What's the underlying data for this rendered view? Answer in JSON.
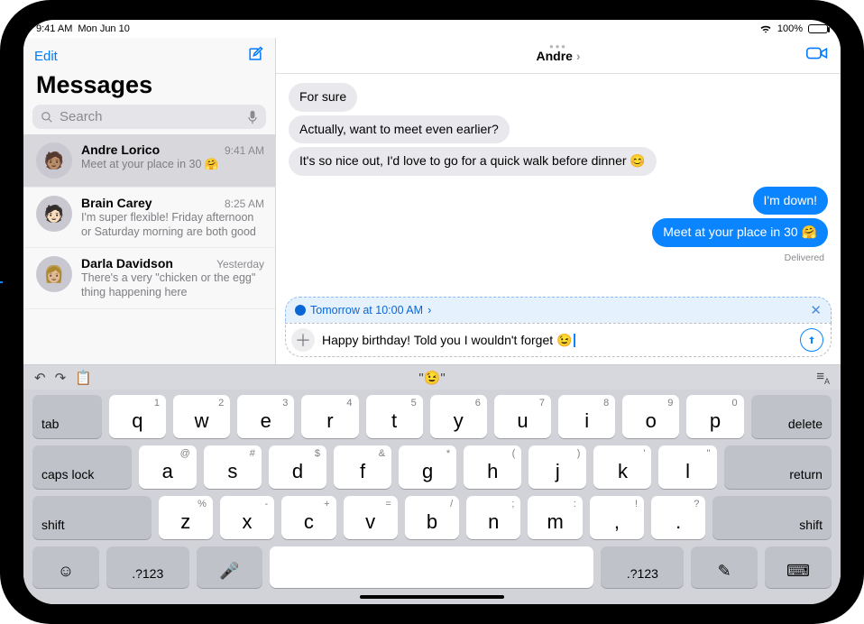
{
  "status": {
    "time": "9:41 AM",
    "date": "Mon Jun 10",
    "battery": "100%"
  },
  "sidebar": {
    "edit": "Edit",
    "title": "Messages",
    "search_placeholder": "Search",
    "conversations": [
      {
        "name": "Andre Lorico",
        "time": "9:41 AM",
        "preview": "Meet at your place in 30 🤗"
      },
      {
        "name": "Brain Carey",
        "time": "8:25 AM",
        "preview": "I'm super flexible! Friday afternoon or Saturday morning are both good"
      },
      {
        "name": "Darla Davidson",
        "time": "Yesterday",
        "preview": "There's a very \"chicken or the egg\" thing happening here"
      }
    ]
  },
  "chat": {
    "title": "Andre",
    "incoming": [
      "For sure",
      "Actually, want to meet even earlier?",
      "It's so nice out, I'd love to go for a quick walk before dinner 😊"
    ],
    "outgoing": [
      "I'm down!",
      "Meet at your place in 30 🤗"
    ],
    "delivered": "Delivered",
    "schedule_label": "Tomorrow at 10:00 AM",
    "compose_text": "Happy birthday! Told you I wouldn't forget 😉"
  },
  "kb_bar": {
    "emoji_suggestion": "\"😉\""
  },
  "keys": {
    "row1": [
      {
        "m": "q",
        "a": "1"
      },
      {
        "m": "w",
        "a": "2"
      },
      {
        "m": "e",
        "a": "3"
      },
      {
        "m": "r",
        "a": "4"
      },
      {
        "m": "t",
        "a": "5"
      },
      {
        "m": "y",
        "a": "6"
      },
      {
        "m": "u",
        "a": "7"
      },
      {
        "m": "i",
        "a": "8"
      },
      {
        "m": "o",
        "a": "9"
      },
      {
        "m": "p",
        "a": "0"
      }
    ],
    "row2": [
      {
        "m": "a",
        "a": "@"
      },
      {
        "m": "s",
        "a": "#"
      },
      {
        "m": "d",
        "a": "$"
      },
      {
        "m": "f",
        "a": "&"
      },
      {
        "m": "g",
        "a": "*"
      },
      {
        "m": "h",
        "a": "("
      },
      {
        "m": "j",
        "a": ")"
      },
      {
        "m": "k",
        "a": "'"
      },
      {
        "m": "l",
        "a": "\""
      }
    ],
    "row3": [
      {
        "m": "z",
        "a": "%"
      },
      {
        "m": "x",
        "a": "-"
      },
      {
        "m": "c",
        "a": "+"
      },
      {
        "m": "v",
        "a": "="
      },
      {
        "m": "b",
        "a": "/"
      },
      {
        "m": "n",
        "a": ";"
      },
      {
        "m": "m",
        "a": ":"
      },
      {
        "m": ",",
        "a": "!"
      },
      {
        "m": ".",
        "a": "?"
      }
    ],
    "tab": "tab",
    "delete": "delete",
    "caps": "caps lock",
    "return": "return",
    "shift": "shift",
    "numbers": ".?123"
  }
}
